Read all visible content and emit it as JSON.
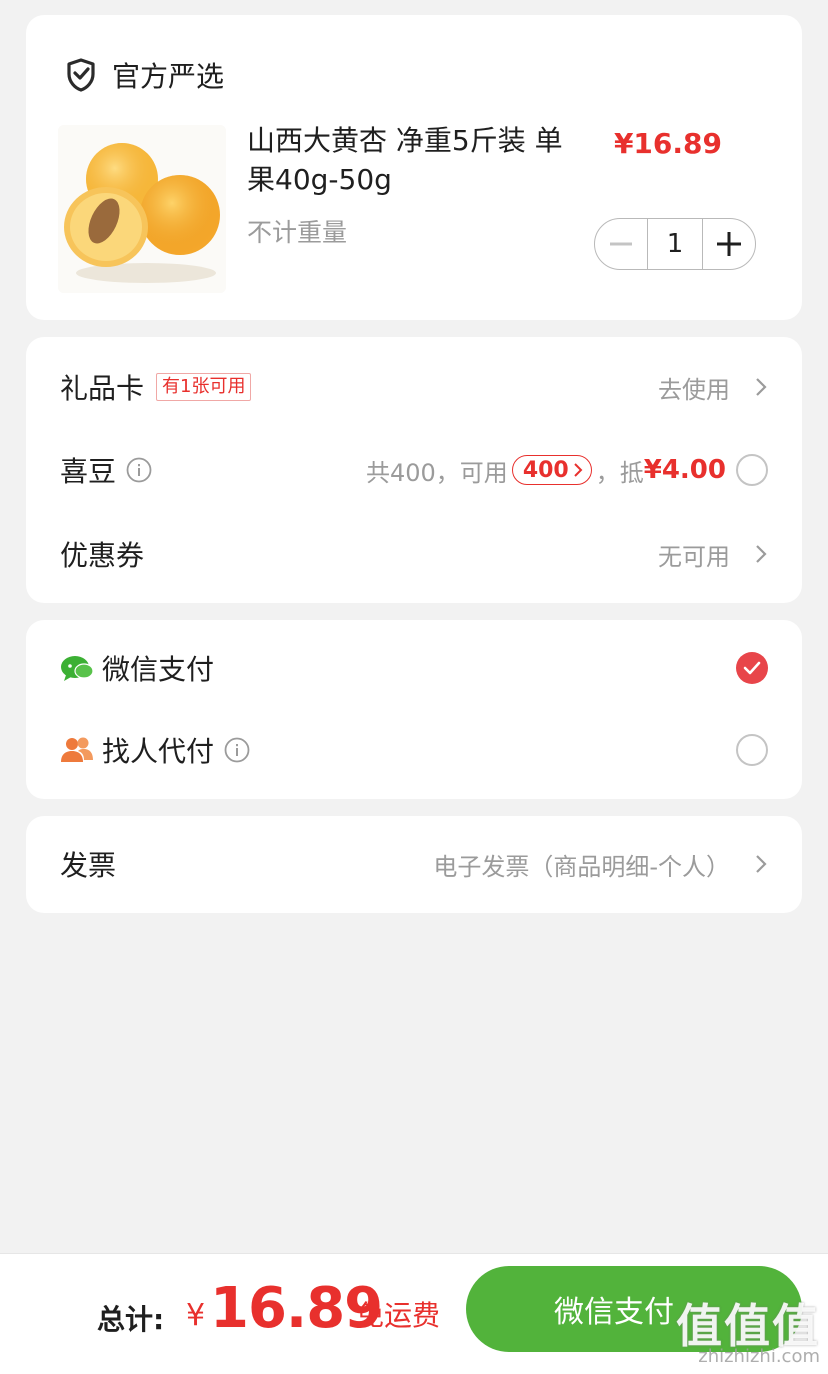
{
  "shop": {
    "name": "官方严选",
    "icon": "shield-check-icon"
  },
  "product": {
    "title": "山西大黄杏 净重5斤装 单果40g-50g",
    "spec": "不计重量",
    "price": "¥16.89",
    "quantity": "1",
    "image": "apricot-image"
  },
  "benefits": {
    "gift_card": {
      "label": "礼品卡",
      "tag": "有1张可用",
      "action": "去使用"
    },
    "xidou": {
      "label": "喜豆",
      "total_text": "共400，可用",
      "usable": "400",
      "sep": "，抵",
      "deduct": "¥4.00"
    },
    "coupon": {
      "label": "优惠券",
      "status": "无可用"
    }
  },
  "payment": {
    "wechat": {
      "label": "微信支付",
      "selected": true
    },
    "proxy": {
      "label": "找人代付",
      "selected": false
    }
  },
  "invoice": {
    "label": "发票",
    "value": "电子发票（商品明细-个人）"
  },
  "footer": {
    "total_label": "总计:",
    "currency": "¥",
    "total": "16.89",
    "shipping": "免运费",
    "pay_button": "微信支付"
  },
  "watermark": {
    "main": "值值值",
    "sub": "zhizhizhi.com"
  },
  "colors": {
    "accent_red": "#e8302d",
    "wechat_green": "#52b33b",
    "background": "#f2f2f2"
  }
}
